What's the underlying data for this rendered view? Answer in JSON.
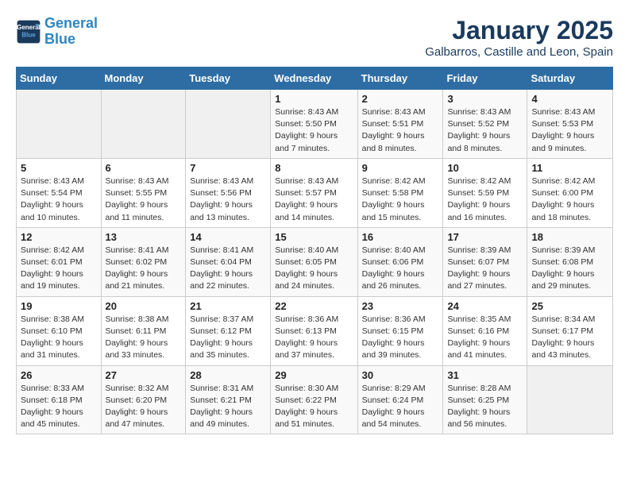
{
  "logo": {
    "line1": "General",
    "line2": "Blue"
  },
  "title": "January 2025",
  "location": "Galbarros, Castille and Leon, Spain",
  "weekdays": [
    "Sunday",
    "Monday",
    "Tuesday",
    "Wednesday",
    "Thursday",
    "Friday",
    "Saturday"
  ],
  "weeks": [
    [
      {
        "day": "",
        "info": ""
      },
      {
        "day": "",
        "info": ""
      },
      {
        "day": "",
        "info": ""
      },
      {
        "day": "1",
        "info": "Sunrise: 8:43 AM\nSunset: 5:50 PM\nDaylight: 9 hours\nand 7 minutes."
      },
      {
        "day": "2",
        "info": "Sunrise: 8:43 AM\nSunset: 5:51 PM\nDaylight: 9 hours\nand 8 minutes."
      },
      {
        "day": "3",
        "info": "Sunrise: 8:43 AM\nSunset: 5:52 PM\nDaylight: 9 hours\nand 8 minutes."
      },
      {
        "day": "4",
        "info": "Sunrise: 8:43 AM\nSunset: 5:53 PM\nDaylight: 9 hours\nand 9 minutes."
      }
    ],
    [
      {
        "day": "5",
        "info": "Sunrise: 8:43 AM\nSunset: 5:54 PM\nDaylight: 9 hours\nand 10 minutes."
      },
      {
        "day": "6",
        "info": "Sunrise: 8:43 AM\nSunset: 5:55 PM\nDaylight: 9 hours\nand 11 minutes."
      },
      {
        "day": "7",
        "info": "Sunrise: 8:43 AM\nSunset: 5:56 PM\nDaylight: 9 hours\nand 13 minutes."
      },
      {
        "day": "8",
        "info": "Sunrise: 8:43 AM\nSunset: 5:57 PM\nDaylight: 9 hours\nand 14 minutes."
      },
      {
        "day": "9",
        "info": "Sunrise: 8:42 AM\nSunset: 5:58 PM\nDaylight: 9 hours\nand 15 minutes."
      },
      {
        "day": "10",
        "info": "Sunrise: 8:42 AM\nSunset: 5:59 PM\nDaylight: 9 hours\nand 16 minutes."
      },
      {
        "day": "11",
        "info": "Sunrise: 8:42 AM\nSunset: 6:00 PM\nDaylight: 9 hours\nand 18 minutes."
      }
    ],
    [
      {
        "day": "12",
        "info": "Sunrise: 8:42 AM\nSunset: 6:01 PM\nDaylight: 9 hours\nand 19 minutes."
      },
      {
        "day": "13",
        "info": "Sunrise: 8:41 AM\nSunset: 6:02 PM\nDaylight: 9 hours\nand 21 minutes."
      },
      {
        "day": "14",
        "info": "Sunrise: 8:41 AM\nSunset: 6:04 PM\nDaylight: 9 hours\nand 22 minutes."
      },
      {
        "day": "15",
        "info": "Sunrise: 8:40 AM\nSunset: 6:05 PM\nDaylight: 9 hours\nand 24 minutes."
      },
      {
        "day": "16",
        "info": "Sunrise: 8:40 AM\nSunset: 6:06 PM\nDaylight: 9 hours\nand 26 minutes."
      },
      {
        "day": "17",
        "info": "Sunrise: 8:39 AM\nSunset: 6:07 PM\nDaylight: 9 hours\nand 27 minutes."
      },
      {
        "day": "18",
        "info": "Sunrise: 8:39 AM\nSunset: 6:08 PM\nDaylight: 9 hours\nand 29 minutes."
      }
    ],
    [
      {
        "day": "19",
        "info": "Sunrise: 8:38 AM\nSunset: 6:10 PM\nDaylight: 9 hours\nand 31 minutes."
      },
      {
        "day": "20",
        "info": "Sunrise: 8:38 AM\nSunset: 6:11 PM\nDaylight: 9 hours\nand 33 minutes."
      },
      {
        "day": "21",
        "info": "Sunrise: 8:37 AM\nSunset: 6:12 PM\nDaylight: 9 hours\nand 35 minutes."
      },
      {
        "day": "22",
        "info": "Sunrise: 8:36 AM\nSunset: 6:13 PM\nDaylight: 9 hours\nand 37 minutes."
      },
      {
        "day": "23",
        "info": "Sunrise: 8:36 AM\nSunset: 6:15 PM\nDaylight: 9 hours\nand 39 minutes."
      },
      {
        "day": "24",
        "info": "Sunrise: 8:35 AM\nSunset: 6:16 PM\nDaylight: 9 hours\nand 41 minutes."
      },
      {
        "day": "25",
        "info": "Sunrise: 8:34 AM\nSunset: 6:17 PM\nDaylight: 9 hours\nand 43 minutes."
      }
    ],
    [
      {
        "day": "26",
        "info": "Sunrise: 8:33 AM\nSunset: 6:18 PM\nDaylight: 9 hours\nand 45 minutes."
      },
      {
        "day": "27",
        "info": "Sunrise: 8:32 AM\nSunset: 6:20 PM\nDaylight: 9 hours\nand 47 minutes."
      },
      {
        "day": "28",
        "info": "Sunrise: 8:31 AM\nSunset: 6:21 PM\nDaylight: 9 hours\nand 49 minutes."
      },
      {
        "day": "29",
        "info": "Sunrise: 8:30 AM\nSunset: 6:22 PM\nDaylight: 9 hours\nand 51 minutes."
      },
      {
        "day": "30",
        "info": "Sunrise: 8:29 AM\nSunset: 6:24 PM\nDaylight: 9 hours\nand 54 minutes."
      },
      {
        "day": "31",
        "info": "Sunrise: 8:28 AM\nSunset: 6:25 PM\nDaylight: 9 hours\nand 56 minutes."
      },
      {
        "day": "",
        "info": ""
      }
    ]
  ]
}
